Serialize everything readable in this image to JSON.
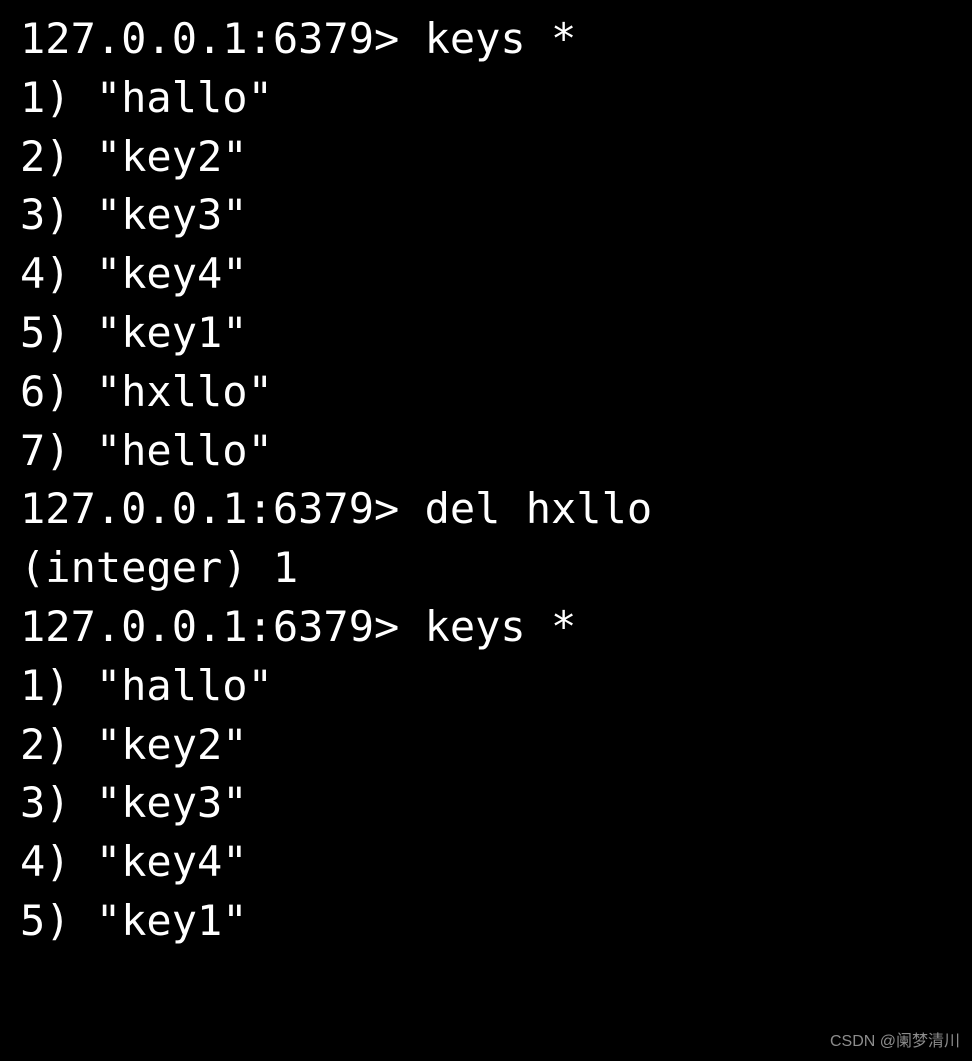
{
  "terminal": {
    "lines": [
      {
        "prompt": "127.0.0.1:6379> ",
        "command": "keys *"
      },
      {
        "text": "1) \"hallo\""
      },
      {
        "text": "2) \"key2\""
      },
      {
        "text": "3) \"key3\""
      },
      {
        "text": "4) \"key4\""
      },
      {
        "text": "5) \"key1\""
      },
      {
        "text": "6) \"hxllo\""
      },
      {
        "text": "7) \"hello\""
      },
      {
        "prompt": "127.0.0.1:6379> ",
        "command": "del hxllo"
      },
      {
        "text": "(integer) 1"
      },
      {
        "prompt": "127.0.0.1:6379> ",
        "command": "keys *"
      },
      {
        "text": "1) \"hallo\""
      },
      {
        "text": "2) \"key2\""
      },
      {
        "text": "3) \"key3\""
      },
      {
        "text": "4) \"key4\""
      },
      {
        "text": "5) \"key1\""
      }
    ]
  },
  "watermark": "CSDN @阑梦清川"
}
